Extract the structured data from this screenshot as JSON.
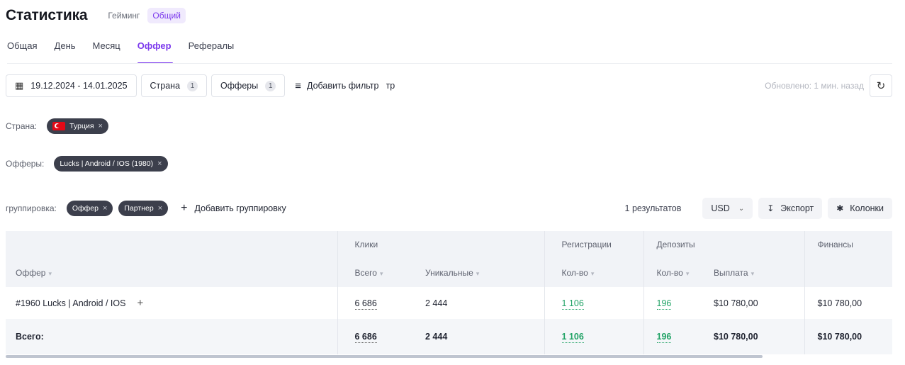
{
  "header": {
    "title": "Статистика",
    "mode_tabs": [
      "Гейминг",
      "Общий"
    ],
    "active_mode": "Общий"
  },
  "subtabs": [
    "Общая",
    "День",
    "Месяц",
    "Оффер",
    "Рефералы"
  ],
  "active_subtab": "Оффер",
  "filters": {
    "date_range": "19.12.2024 - 14.01.2025",
    "country_label": "Страна",
    "country_count": "1",
    "offers_label": "Офферы",
    "offers_count": "1",
    "add_filter": "Добавить фильтр",
    "search_value": "тр",
    "updated": "Обновлено: 1 мин. назад"
  },
  "applied": {
    "country_label": "Страна:",
    "country_value": "Турция",
    "offers_label": "Офферы:",
    "offers_value": "Lucks | Android / IOS (1980)"
  },
  "grouping": {
    "label": "группировка:",
    "chips": [
      "Оффер",
      "Партнер"
    ],
    "add": "Добавить группировку",
    "results": "1 результатов",
    "currency": "USD",
    "export": "Экспорт",
    "columns": "Колонки"
  },
  "table": {
    "groups": {
      "clicks": "Клики",
      "registrations": "Регистрации",
      "deposits": "Депозиты",
      "finance": "Финансы"
    },
    "cols": {
      "offer": "Оффер",
      "total": "Всего",
      "unique": "Уникальные",
      "reg_count": "Кол-во",
      "dep_count": "Кол-во",
      "payout": "Выплата"
    },
    "row": {
      "offer": "#1960 Lucks | Android / IOS",
      "clicks_total": "6 686",
      "clicks_unique": "2 444",
      "registrations": "1 106",
      "deposits": "196",
      "payout": "$10 780,00",
      "finance": "$10 780,00"
    },
    "total": {
      "label": "Всего:",
      "clicks_total": "6 686",
      "clicks_unique": "2 444",
      "registrations": "1 106",
      "deposits": "196",
      "payout": "$10 780,00",
      "finance": "$10 780,00"
    }
  },
  "colors": {
    "accent": "#7c3aed",
    "green": "#21a366",
    "chip": "#3c3f4c"
  },
  "icons": [
    "calendar-icon",
    "filter-icon",
    "refresh-icon",
    "close-icon",
    "plus-icon",
    "download-icon",
    "gear-icon",
    "chevron-down-icon",
    "sort-icon",
    "flag-icon"
  ]
}
